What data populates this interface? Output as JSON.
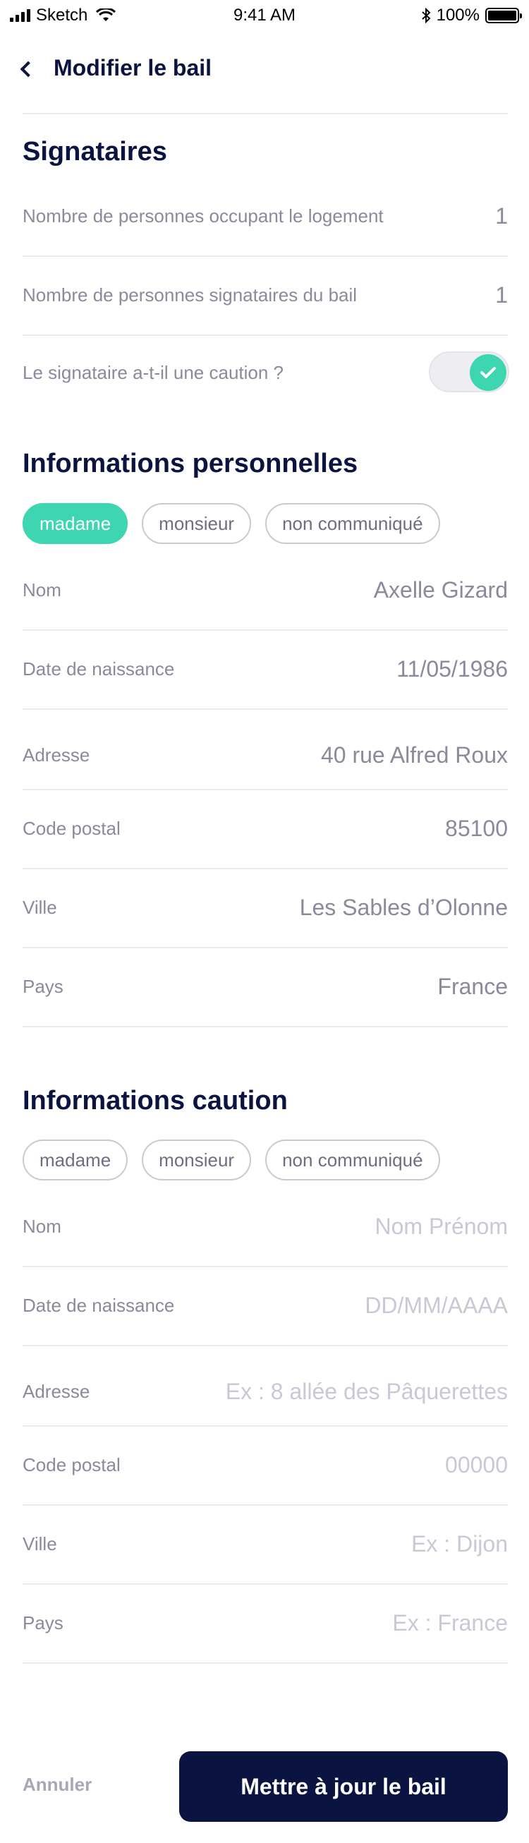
{
  "status_bar": {
    "carrier": "Sketch",
    "time": "9:41 AM",
    "battery": "100%"
  },
  "header": {
    "title": "Modifier le bail"
  },
  "signataires": {
    "title": "Signataires",
    "rows": [
      {
        "label": "Nombre de personnes occupant le logement",
        "value": "1"
      },
      {
        "label": "Nombre de personnes signataires du bail",
        "value": "1"
      },
      {
        "label": "Le signataire a-t-il une caution ?",
        "toggle_on": true
      }
    ]
  },
  "perso": {
    "title": "Informations personnelles",
    "chips": [
      {
        "label": "madame",
        "active": true
      },
      {
        "label": "monsieur",
        "active": false
      },
      {
        "label": "non communiqué",
        "active": false
      }
    ],
    "fields": [
      {
        "label": "Nom",
        "value": "Axelle Gizard"
      },
      {
        "label": "Date de naissance",
        "value": "11/05/1986"
      },
      {
        "label": "Adresse",
        "value": "40 rue Alfred Roux"
      },
      {
        "label": "Code postal",
        "value": "85100"
      },
      {
        "label": "Ville",
        "value": "Les Sables d’Olonne"
      },
      {
        "label": "Pays",
        "value": "France"
      }
    ]
  },
  "caution": {
    "title": "Informations caution",
    "chips": [
      {
        "label": "madame",
        "active": false
      },
      {
        "label": "monsieur",
        "active": false
      },
      {
        "label": "non communiqué",
        "active": false
      }
    ],
    "fields": [
      {
        "label": "Nom",
        "placeholder": "Nom Prénom"
      },
      {
        "label": "Date de naissance",
        "placeholder": "DD/MM/AAAA"
      },
      {
        "label": "Adresse",
        "placeholder": "Ex : 8 allée des Pâquerettes"
      },
      {
        "label": "Code postal",
        "placeholder": "00000"
      },
      {
        "label": "Ville",
        "placeholder": "Ex : Dijon"
      },
      {
        "label": "Pays",
        "placeholder": "Ex : France"
      }
    ]
  },
  "footer": {
    "cancel": "Annuler",
    "submit": "Mettre à jour le bail"
  },
  "colors": {
    "accent": "#3ed6b0",
    "navy": "#0b1440"
  }
}
